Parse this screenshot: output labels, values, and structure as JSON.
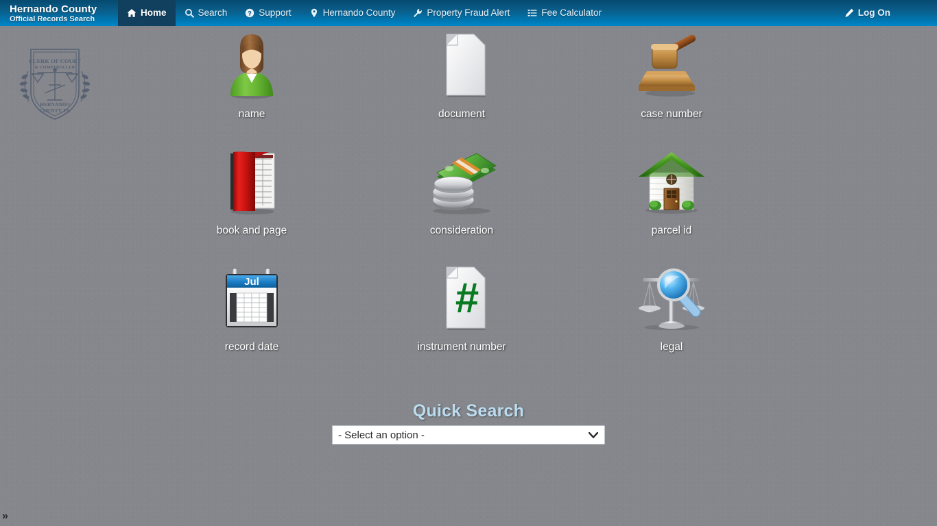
{
  "brand": {
    "title": "Hernando County",
    "subtitle": "Official Records Search"
  },
  "nav": {
    "items": [
      {
        "label": "Home",
        "icon": "home-icon",
        "active": true
      },
      {
        "label": "Search",
        "icon": "search-icon",
        "active": false
      },
      {
        "label": "Support",
        "icon": "question-circle-icon",
        "active": false
      },
      {
        "label": "Hernando County",
        "icon": "map-marker-icon",
        "active": false
      },
      {
        "label": "Property Fraud Alert",
        "icon": "wrench-icon",
        "active": false
      },
      {
        "label": "Fee Calculator",
        "icon": "list-icon",
        "active": false
      }
    ],
    "logon": {
      "label": "Log On",
      "icon": "pencil-icon"
    }
  },
  "seal": {
    "line1": "CLERK OF COURT",
    "line2": "& COMPTROLLER",
    "line3": "HERNANDO",
    "line4": "COUNTY, FL"
  },
  "search_tiles": [
    {
      "label": "name",
      "icon": "person-icon"
    },
    {
      "label": "document",
      "icon": "document-page-icon"
    },
    {
      "label": "case number",
      "icon": "gavel-icon"
    },
    {
      "label": "book and page",
      "icon": "red-book-icon"
    },
    {
      "label": "consideration",
      "icon": "money-coins-icon"
    },
    {
      "label": "parcel id",
      "icon": "house-icon"
    },
    {
      "label": "record date",
      "icon": "calendar-icon"
    },
    {
      "label": "instrument number",
      "icon": "hash-document-icon"
    },
    {
      "label": "legal",
      "icon": "scales-magnifier-icon"
    }
  ],
  "quick_search": {
    "title": "Quick Search",
    "selected_option": "- Select an option -"
  },
  "footer": {
    "expand_label": "»"
  },
  "colors": {
    "nav_top": "#064a70",
    "nav_bottom": "#0086c9",
    "nav_active": "#113f5e",
    "page_background": "#85878c",
    "quick_title": "#bcdcef",
    "label_text": "#ffffff"
  },
  "calendar_icon": {
    "month": "Jul"
  },
  "hash_icon": {
    "symbol": "#"
  }
}
